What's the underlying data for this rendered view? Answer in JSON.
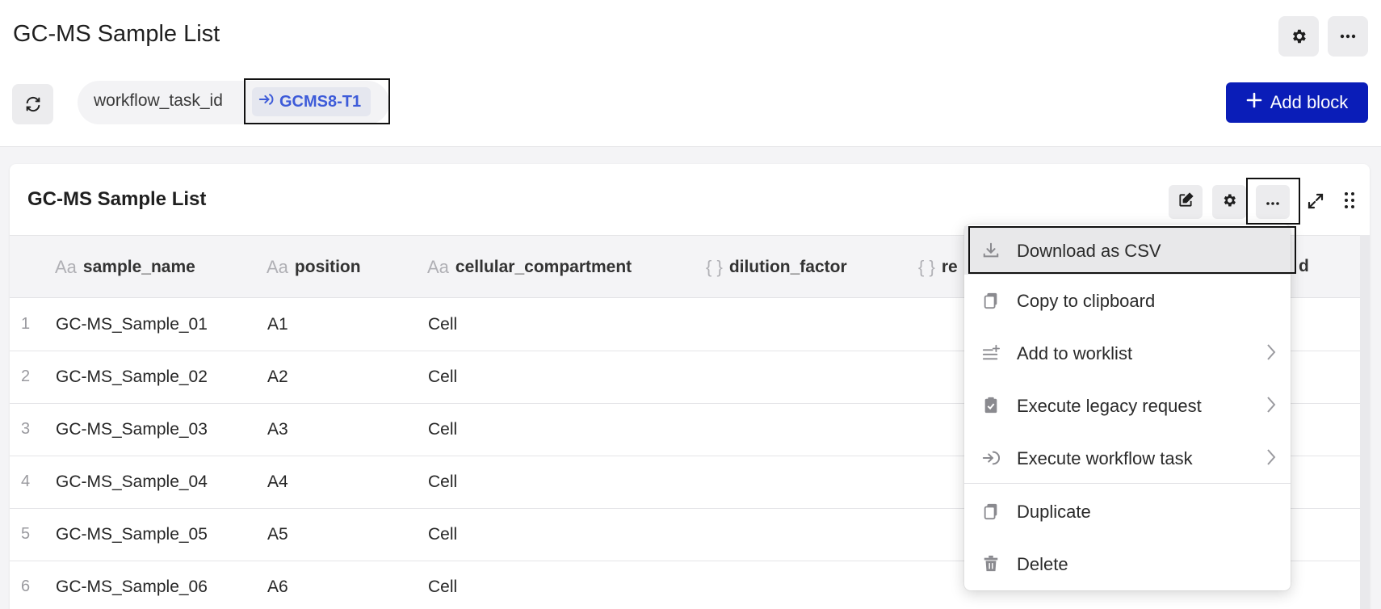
{
  "header": {
    "title": "GC-MS Sample List",
    "settings_icon": "gear-icon",
    "more_icon": "more-horizontal-icon"
  },
  "filter": {
    "refresh_icon": "refresh-icon",
    "key": "workflow_task_id",
    "value": "GCMS8-T1",
    "value_icon": "arrow-into-icon"
  },
  "add_block": {
    "label": "Add block",
    "icon": "plus-icon"
  },
  "card": {
    "title": "GC-MS Sample List",
    "actions": [
      "edit-icon",
      "gear-icon",
      "more-horizontal-icon",
      "expand-icon",
      "drag-handle-icon"
    ]
  },
  "table": {
    "columns": [
      {
        "type_icon": "Aa",
        "name": "sample_name"
      },
      {
        "type_icon": "Aa",
        "name": "position"
      },
      {
        "type_icon": "Aa",
        "name": "cellular_compartment"
      },
      {
        "type_icon": "{ }",
        "name": "dilution_factor"
      },
      {
        "type_icon": "{ }",
        "name": "re"
      },
      {
        "type_icon": "",
        "name": "d"
      }
    ],
    "rows": [
      {
        "num": "1",
        "sample_name": "GC-MS_Sample_01",
        "position": "A1",
        "cellular_compartment": "Cell"
      },
      {
        "num": "2",
        "sample_name": "GC-MS_Sample_02",
        "position": "A2",
        "cellular_compartment": "Cell"
      },
      {
        "num": "3",
        "sample_name": "GC-MS_Sample_03",
        "position": "A3",
        "cellular_compartment": "Cell"
      },
      {
        "num": "4",
        "sample_name": "GC-MS_Sample_04",
        "position": "A4",
        "cellular_compartment": "Cell"
      },
      {
        "num": "5",
        "sample_name": "GC-MS_Sample_05",
        "position": "A5",
        "cellular_compartment": "Cell"
      },
      {
        "num": "6",
        "sample_name": "GC-MS_Sample_06",
        "position": "A6",
        "cellular_compartment": "Cell"
      }
    ]
  },
  "menu": {
    "items": [
      {
        "label": "Download as CSV",
        "icon": "download-icon",
        "submenu": false
      },
      {
        "label": "Copy to clipboard",
        "icon": "clipboard-icon",
        "submenu": false
      },
      {
        "label": "Add to worklist",
        "icon": "list-add-icon",
        "submenu": true
      },
      {
        "label": "Execute legacy request",
        "icon": "clipboard-check-icon",
        "submenu": true
      },
      {
        "label": "Execute workflow task",
        "icon": "arrow-into-icon",
        "submenu": true
      },
      {
        "label": "Duplicate",
        "icon": "copy-icon",
        "submenu": false
      },
      {
        "label": "Delete",
        "icon": "trash-icon",
        "submenu": false
      }
    ]
  },
  "colors": {
    "accent": "#0a1db8",
    "chip_text": "#3d5bd9"
  }
}
